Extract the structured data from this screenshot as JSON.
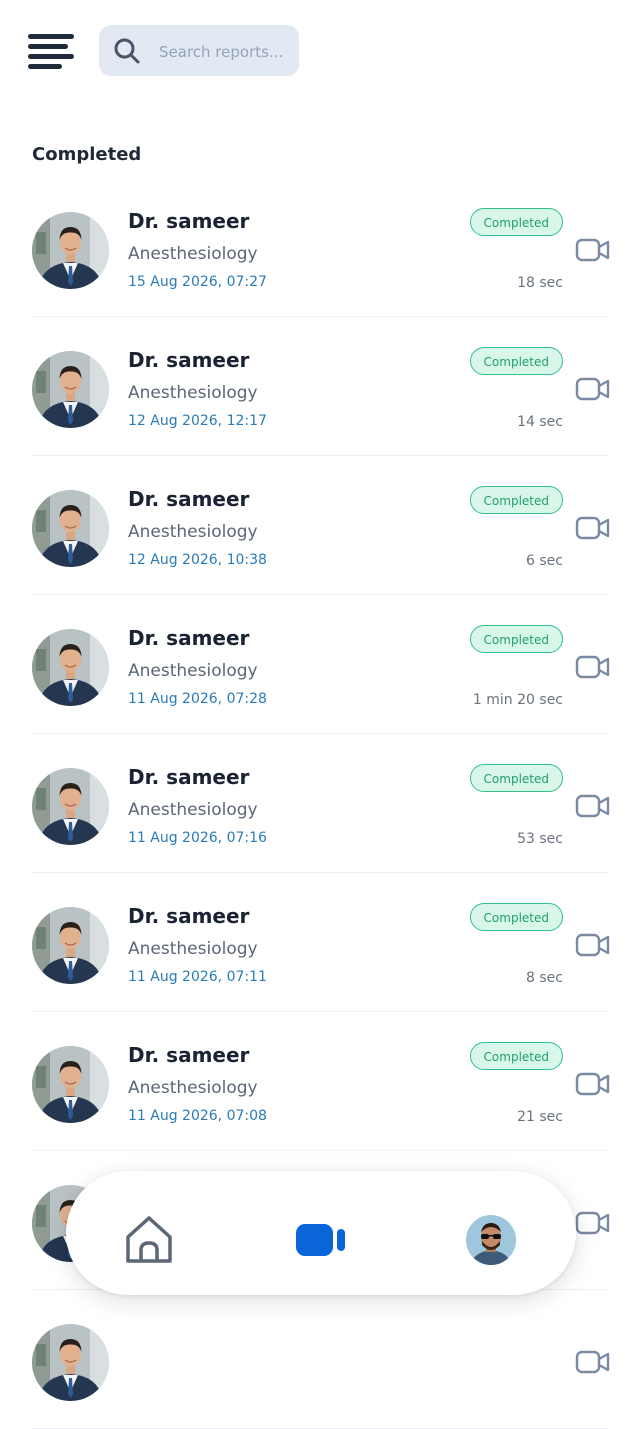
{
  "header": {
    "search": {
      "placeholder": "Search reports...",
      "value": ""
    }
  },
  "section_title": "Completed",
  "consultations": [
    {
      "doctor": "Dr. sameer",
      "specialty": "Anesthesiology",
      "datetime": "15 Aug 2026, 07:27",
      "status": "Completed",
      "duration": "18 sec"
    },
    {
      "doctor": "Dr. sameer",
      "specialty": "Anesthesiology",
      "datetime": "12 Aug 2026, 12:17",
      "status": "Completed",
      "duration": "14 sec"
    },
    {
      "doctor": "Dr. sameer",
      "specialty": "Anesthesiology",
      "datetime": "12 Aug 2026, 10:38",
      "status": "Completed",
      "duration": "6 sec"
    },
    {
      "doctor": "Dr. sameer",
      "specialty": "Anesthesiology",
      "datetime": "11 Aug 2026, 07:28",
      "status": "Completed",
      "duration": "1 min 20 sec"
    },
    {
      "doctor": "Dr. sameer",
      "specialty": "Anesthesiology",
      "datetime": "11 Aug 2026, 07:16",
      "status": "Completed",
      "duration": "53 sec"
    },
    {
      "doctor": "Dr. sameer",
      "specialty": "Anesthesiology",
      "datetime": "11 Aug 2026, 07:11",
      "status": "Completed",
      "duration": "8 sec"
    },
    {
      "doctor": "Dr. sameer",
      "specialty": "Anesthesiology",
      "datetime": "11 Aug 2026, 07:08",
      "status": "Completed",
      "duration": "21 sec"
    },
    {
      "doctor": "",
      "specialty": "",
      "datetime": "",
      "status": "",
      "duration": ""
    },
    {
      "doctor": "",
      "specialty": "",
      "datetime": "",
      "status": "",
      "duration": ""
    }
  ],
  "icons": {
    "menu": "menu-icon",
    "search": "search-icon",
    "row_action": "video-camera-icon",
    "nav_home": "home-icon",
    "nav_video": "video-call-icon",
    "nav_profile": "user-avatar"
  },
  "colors": {
    "accent": "#0a66d8",
    "badge_border": "#34c08a",
    "badge_bg": "#d9f6ea",
    "badge_text": "#21a06f",
    "date_text": "#2a7bb6",
    "search_bg": "#e3e9f2"
  },
  "bottom_nav": {
    "active": "video"
  }
}
